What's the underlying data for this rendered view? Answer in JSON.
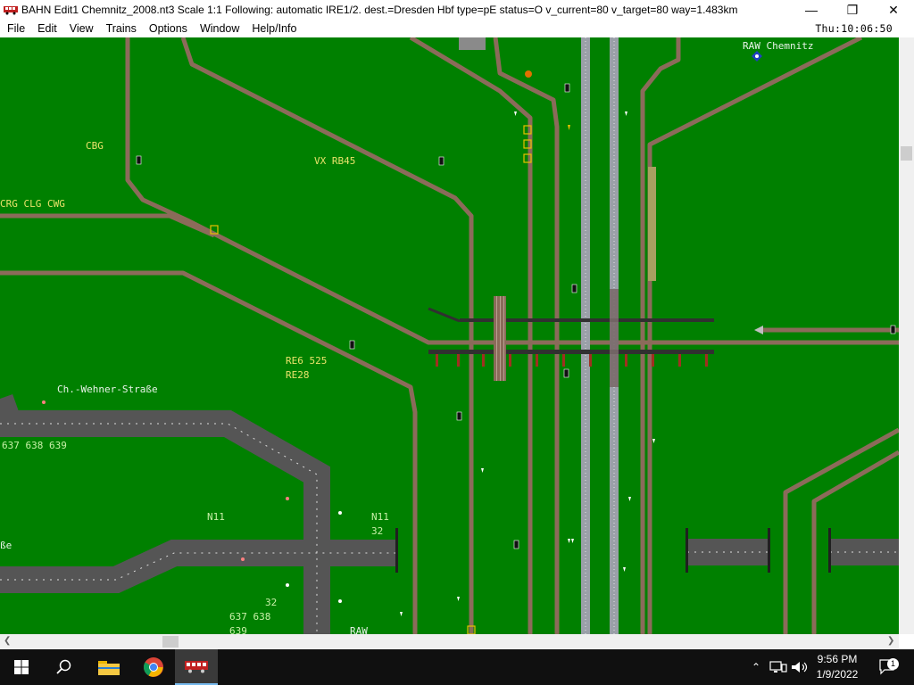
{
  "window": {
    "title": "BAHN Edit1 Chemnitz_2008.nt3 Scale 1:1 Following: automatic IRE1/2.  dest.=Dresden Hbf type=pE status=O  v_current=80 v_target=80 way=1.483km",
    "minimize": "—",
    "maximize": "❐",
    "close": "✕"
  },
  "menu": [
    "File",
    "Edit",
    "View",
    "Trains",
    "Options",
    "Window",
    "Help/Info"
  ],
  "clock": "Thu:10:06:50",
  "map": {
    "labels": {
      "cbg": "CBG",
      "vx_rb45": "VX RB45",
      "crg": "CRG CLG CWG",
      "raw_chemnitz": "RAW Chemnitz",
      "re6": "RE6 525",
      "re28": "RE28",
      "wehner": "Ch.-Wehner-Straße",
      "bus_637": "637 638 639",
      "n11_a": "N11",
      "n11_b": "N11",
      "n11_32": "32",
      "sse": "ße",
      "b32": "32",
      "b637": "637 638",
      "b639": "639",
      "raw": "RAW"
    }
  },
  "taskbar": {
    "time": "9:56 PM",
    "date": "1/9/2022",
    "notifications": "1"
  },
  "colors": {
    "grass": "#008000",
    "rail": "#8b6b5a",
    "road": "#555555",
    "label_yellow": "#e8e26a"
  }
}
